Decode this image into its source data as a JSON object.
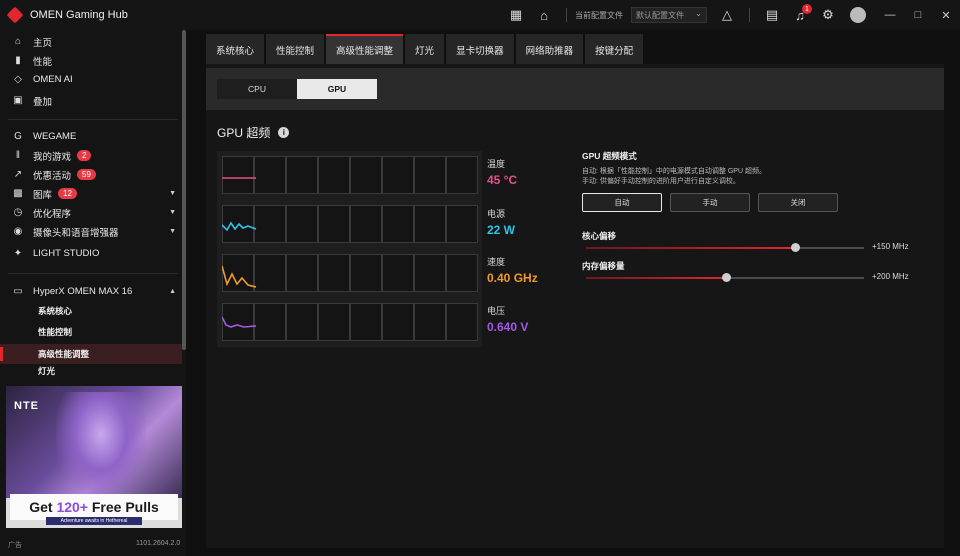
{
  "titlebar": {
    "app_title": "OMEN Gaming Hub",
    "profile_label": "当前配置文件",
    "profile_value": "默认配置文件",
    "notification_count": "1"
  },
  "sidebar": {
    "items": [
      {
        "label": "主页",
        "icon": "home-icon"
      },
      {
        "label": "性能",
        "icon": "bar-chart-icon"
      },
      {
        "label": "OMEN AI",
        "icon": "diamond-icon"
      },
      {
        "label": "叠加",
        "icon": "overlay-icon"
      },
      {
        "label": "WEGAME",
        "icon": "wegame-icon"
      },
      {
        "label": "我的游戏",
        "icon": "library-icon",
        "count": "2"
      },
      {
        "label": "优惠活动",
        "icon": "trend-icon",
        "count": "59"
      },
      {
        "label": "图库",
        "icon": "gallery-icon",
        "count": "12"
      },
      {
        "label": "优化程序",
        "icon": "optimizer-icon"
      },
      {
        "label": "摄像头和语音增强器",
        "icon": "camera-icon"
      },
      {
        "label": "LIGHT STUDIO",
        "icon": "light-studio-icon"
      },
      {
        "label": "HyperX OMEN MAX 16",
        "icon": "laptop-icon"
      }
    ],
    "sub_items": [
      {
        "label": "系统核心"
      },
      {
        "label": "性能控制"
      },
      {
        "label": "高级性能调整"
      },
      {
        "label": "灯光"
      }
    ],
    "ad": {
      "logo": "NTE",
      "headline_prefix": "Get ",
      "headline_highlight": "120+",
      "headline_suffix": " Free Pulls",
      "subline": "Adventure awaits in Hethereal"
    },
    "ad_label": "广告",
    "version": "1101.2604.2.0"
  },
  "tabs": [
    {
      "label": "系统核心"
    },
    {
      "label": "性能控制"
    },
    {
      "label": "高级性能调整"
    },
    {
      "label": "灯光"
    },
    {
      "label": "显卡切换器"
    },
    {
      "label": "网络助推器"
    },
    {
      "label": "按键分配"
    }
  ],
  "segments": {
    "cpu": "CPU",
    "gpu": "GPU"
  },
  "section": {
    "title": "GPU 超频"
  },
  "metrics": [
    {
      "label": "温度",
      "value": "45 °C",
      "color": "#e6508e"
    },
    {
      "label": "电源",
      "value": "22 W",
      "color": "#2fc3e8"
    },
    {
      "label": "速度",
      "value": "0.40 GHz",
      "color": "#f09a2a"
    },
    {
      "label": "电压",
      "value": "0.640 V",
      "color": "#a15ae6"
    }
  ],
  "gpu_mode": {
    "title": "GPU 超频模式",
    "desc_auto": "自动: 根据「性能控制」中的电源模式自动调整 GPU 超频。",
    "desc_manual": "手动: 供偏好手动控制的进阶用户进行自定义调校。",
    "buttons": [
      "自动",
      "手动",
      "关闭"
    ]
  },
  "sliders": [
    {
      "title": "核心偏移",
      "value": "+150 MHz",
      "fraction": 0.75
    },
    {
      "title": "内存偏移量",
      "value": "+200 MHz",
      "fraction": 0.505
    }
  ]
}
